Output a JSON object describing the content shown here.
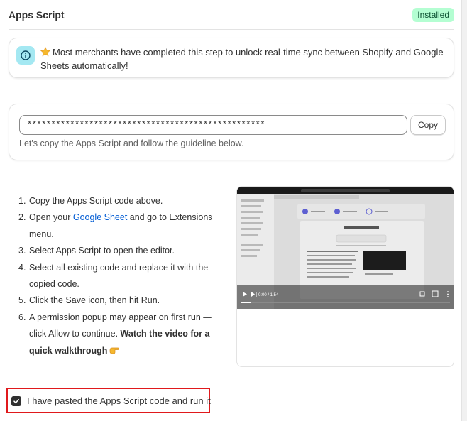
{
  "header": {
    "title": "Apps Script",
    "status_badge": "Installed"
  },
  "banner": {
    "text": "Most merchants have completed this step to unlock real-time sync between Shopify and Google Sheets automatically!"
  },
  "code_section": {
    "code_value": "**************************************************",
    "copy_label": "Copy",
    "hint": "Let's copy the Apps Script and follow the guideline below."
  },
  "steps": [
    {
      "num": "1.",
      "text": "Copy the Apps Script code above."
    },
    {
      "num": "2.",
      "before": "Open your ",
      "link": "Google Sheet",
      "after": " and go to Extensions menu."
    },
    {
      "num": "3.",
      "text": "Select Apps Script to open the editor."
    },
    {
      "num": "4.",
      "text": "Select all existing code and replace it with the copied code."
    },
    {
      "num": "5.",
      "text": "Click the Save icon, then hit Run."
    },
    {
      "num": "6.",
      "text": "A permission popup may appear on first run — click Allow to continue. ",
      "bold": "Watch the video for a quick walkthrough"
    }
  ],
  "video": {
    "time": "0:00 / 1:54"
  },
  "confirmation": {
    "checked": true,
    "label": "I have pasted the Apps Script code and run it"
  },
  "colors": {
    "badge_bg": "#b4fed2",
    "badge_text": "#0c5132",
    "info_icon_bg": "#a4e8f2",
    "link": "#005bd3",
    "highlight_border": "#e0191c"
  }
}
